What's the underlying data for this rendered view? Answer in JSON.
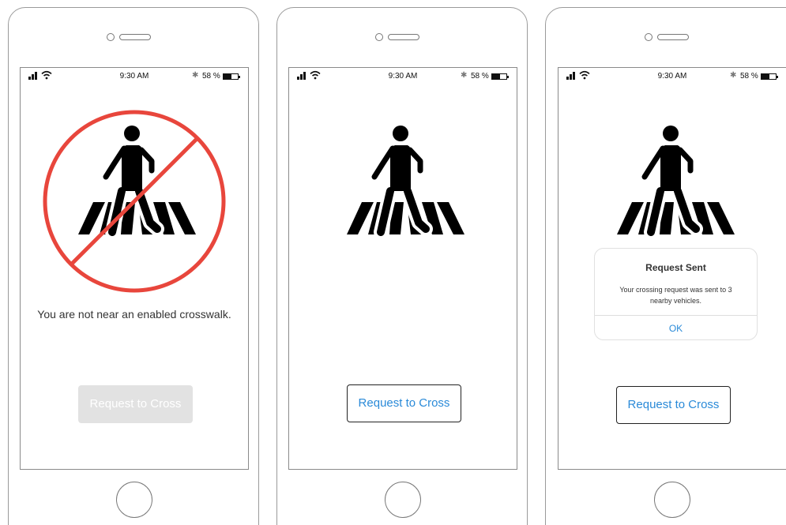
{
  "status_bar": {
    "time": "9:30 AM",
    "battery_percent_text": "58 %",
    "battery_level": 0.58,
    "bluetooth_icon": "bluetooth-icon",
    "signal_icon": "signal-bars-icon",
    "wifi_icon": "wifi-icon"
  },
  "screens": [
    {
      "message": "You are not near an enabled crosswalk.",
      "button_label": "Request to Cross",
      "button_enabled": false,
      "prohibited": true
    },
    {
      "button_label": "Request to Cross",
      "button_enabled": true,
      "prohibited": false
    },
    {
      "button_label": "Request to Cross",
      "button_enabled": true,
      "prohibited": false,
      "alert": {
        "title": "Request Sent",
        "body": "Your crossing request was sent to 3 nearby vehicles.",
        "ok_label": "OK"
      }
    }
  ],
  "colors": {
    "accent_blue": "#2a8ad8",
    "prohibit_red": "#e8463c",
    "disabled_gray": "#e2e2e2"
  }
}
